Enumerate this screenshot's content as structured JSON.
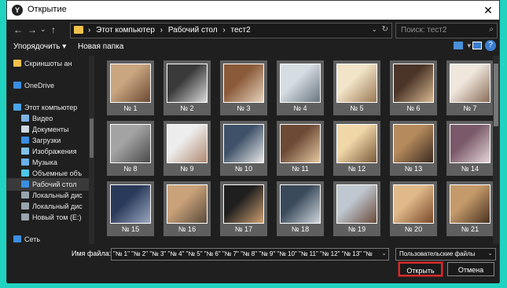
{
  "window": {
    "title": "Открытие",
    "app_icon_letter": "Y",
    "close_glyph": "✕"
  },
  "nav": {
    "back_glyph": "←",
    "forward_glyph": "→",
    "dropdown_glyph": "⌄",
    "up_glyph": "↑",
    "breadcrumbs": [
      "›",
      "Этот компьютер",
      "›",
      "Рабочий стол",
      "›",
      "тест2"
    ],
    "address_dropdown_glyph": "⌄",
    "refresh_glyph": "↻",
    "search_placeholder": "Поиск: тест2",
    "search_glyph": "⌕"
  },
  "toolbar": {
    "organize_label": "Упорядочить ▾",
    "new_folder_label": "Новая папка",
    "view_dropdown_glyph": "▾",
    "help_glyph": "?"
  },
  "sidebar": {
    "items": [
      {
        "label": "Скриншоты ан",
        "icon": "folder-icon",
        "color": "#f0c24b"
      },
      {
        "label": "",
        "icon": "",
        "color": ""
      },
      {
        "label": "OneDrive",
        "icon": "cloud-icon",
        "color": "#3b8ee0"
      },
      {
        "label": "",
        "icon": "",
        "color": ""
      },
      {
        "label": "Этот компьютер",
        "icon": "computer-icon",
        "color": "#4aa3e8"
      },
      {
        "label": "Видео",
        "icon": "video-icon",
        "color": "#7fb3e6"
      },
      {
        "label": "Документы",
        "icon": "documents-icon",
        "color": "#cfd8e3"
      },
      {
        "label": "Загрузки",
        "icon": "download-icon",
        "color": "#3b8ee0"
      },
      {
        "label": "Изображения",
        "icon": "pictures-icon",
        "color": "#7fc2ea"
      },
      {
        "label": "Музыка",
        "icon": "music-icon",
        "color": "#6ab0e8"
      },
      {
        "label": "Объемные объ",
        "icon": "3d-objects-icon",
        "color": "#4ec6e8"
      },
      {
        "label": "Рабочий стол",
        "icon": "desktop-icon",
        "color": "#3b8ee0"
      },
      {
        "label": "Локальный дис",
        "icon": "drive-icon",
        "color": "#9aa4ad"
      },
      {
        "label": "Локальный дис",
        "icon": "drive-icon",
        "color": "#9aa4ad"
      },
      {
        "label": "Новый том (E:)",
        "icon": "drive-icon",
        "color": "#9aa4ad"
      },
      {
        "label": "",
        "icon": "",
        "color": ""
      },
      {
        "label": "Сеть",
        "icon": "network-icon",
        "color": "#3b8ee0"
      }
    ],
    "selected_index": 11
  },
  "files": [
    {
      "label": "№ 1",
      "colors": [
        "#c9a680",
        "#6b4a33"
      ]
    },
    {
      "label": "№ 2",
      "colors": [
        "#3a3a3a",
        "#d9d9d9"
      ]
    },
    {
      "label": "№ 3",
      "colors": [
        "#8a5a3a",
        "#e7d4bd"
      ]
    },
    {
      "label": "№ 4",
      "colors": [
        "#d6dde2",
        "#6a7680"
      ]
    },
    {
      "label": "№ 5",
      "colors": [
        "#f2e4c8",
        "#9a7a55"
      ]
    },
    {
      "label": "№ 6",
      "colors": [
        "#4a3528",
        "#d8b890"
      ]
    },
    {
      "label": "№ 7",
      "colors": [
        "#efe6dc",
        "#8a6f5a"
      ]
    },
    {
      "label": "№ 8",
      "colors": [
        "#a3a3a3",
        "#4a4a4a"
      ]
    },
    {
      "label": "№ 9",
      "colors": [
        "#ededed",
        "#b08970"
      ]
    },
    {
      "label": "№ 10",
      "colors": [
        "#3e5168",
        "#e7e7e7"
      ]
    },
    {
      "label": "№ 11",
      "colors": [
        "#6c4a36",
        "#e6c9a2"
      ]
    },
    {
      "label": "№ 12",
      "colors": [
        "#f0d7a8",
        "#7a5a3a"
      ]
    },
    {
      "label": "№ 13",
      "colors": [
        "#b58a5c",
        "#3b2a20"
      ]
    },
    {
      "label": "№ 14",
      "colors": [
        "#7a5a6a",
        "#e5d5d8"
      ]
    },
    {
      "label": "№ 15",
      "colors": [
        "#2a3a5a",
        "#9aa8c0"
      ]
    },
    {
      "label": "№ 16",
      "colors": [
        "#caa27a",
        "#5a4a3a"
      ]
    },
    {
      "label": "№ 17",
      "colors": [
        "#1f1f1f",
        "#cfa070"
      ]
    },
    {
      "label": "№ 18",
      "colors": [
        "#3a4a5a",
        "#cfd5dc"
      ]
    },
    {
      "label": "№ 19",
      "colors": [
        "#bfc8d0",
        "#6a4a3a"
      ]
    },
    {
      "label": "№ 20",
      "colors": [
        "#e0b98a",
        "#7a4a2a"
      ]
    },
    {
      "label": "№ 21",
      "colors": [
        "#c49a6a",
        "#4a3222"
      ]
    }
  ],
  "footer": {
    "file_name_label": "Имя файла:",
    "file_name_value": "\"№ 1\" \"№ 2\" \"№ 3\" \"№ 4\" \"№ 5\" \"№ 6\" \"№ 7\" \"№ 8\" \"№ 9\" \"№ 10\" \"№ 11\" \"№ 12\" \"№ 13\" \"№",
    "file_name_dropdown_glyph": "⌄",
    "file_type_value": "Пользовательские файлы",
    "file_type_dropdown_glyph": "⌄",
    "open_label": "Открыть",
    "cancel_label": "Отмена"
  }
}
